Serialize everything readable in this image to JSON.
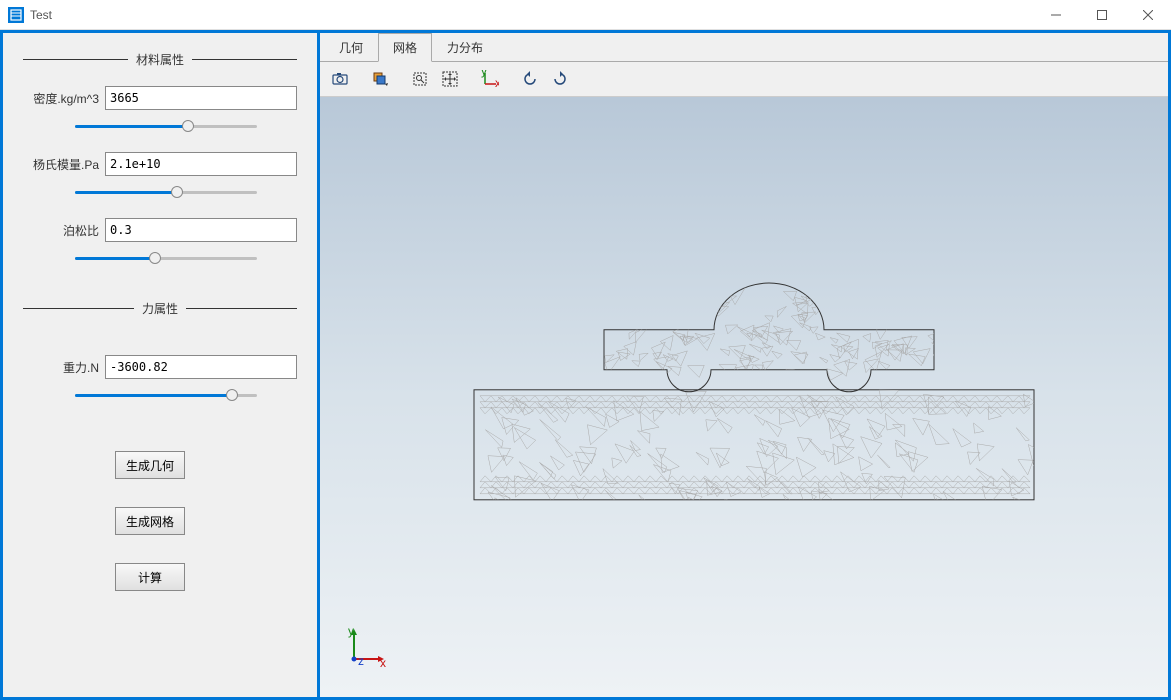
{
  "window": {
    "title": "Test"
  },
  "sidebar": {
    "group_material": "材料属性",
    "group_force": "力属性",
    "density_label": "密度.kg/m^3",
    "density_value": "3665",
    "young_label": "杨氏模量.Pa",
    "young_value": "2.1e+10",
    "poisson_label": "泊松比",
    "poisson_value": "0.3",
    "gravity_label": "重力.N",
    "gravity_value": "-3600.82",
    "btn_geom": "生成几何",
    "btn_mesh": "生成网格",
    "btn_calc": "计算",
    "slider_density_pct": 62,
    "slider_young_pct": 56,
    "slider_poisson_pct": 44,
    "slider_gravity_pct": 86
  },
  "tabs": {
    "items": [
      {
        "label": "几何",
        "active": false
      },
      {
        "label": "网格",
        "active": true
      },
      {
        "label": "力分布",
        "active": false
      }
    ]
  },
  "toolbar": {
    "icons": [
      "camera",
      "layers",
      "select-rect",
      "select-point",
      "axes",
      "rotate-left",
      "rotate-right"
    ]
  },
  "axis": {
    "x": "x",
    "y": "y",
    "z": "z"
  }
}
